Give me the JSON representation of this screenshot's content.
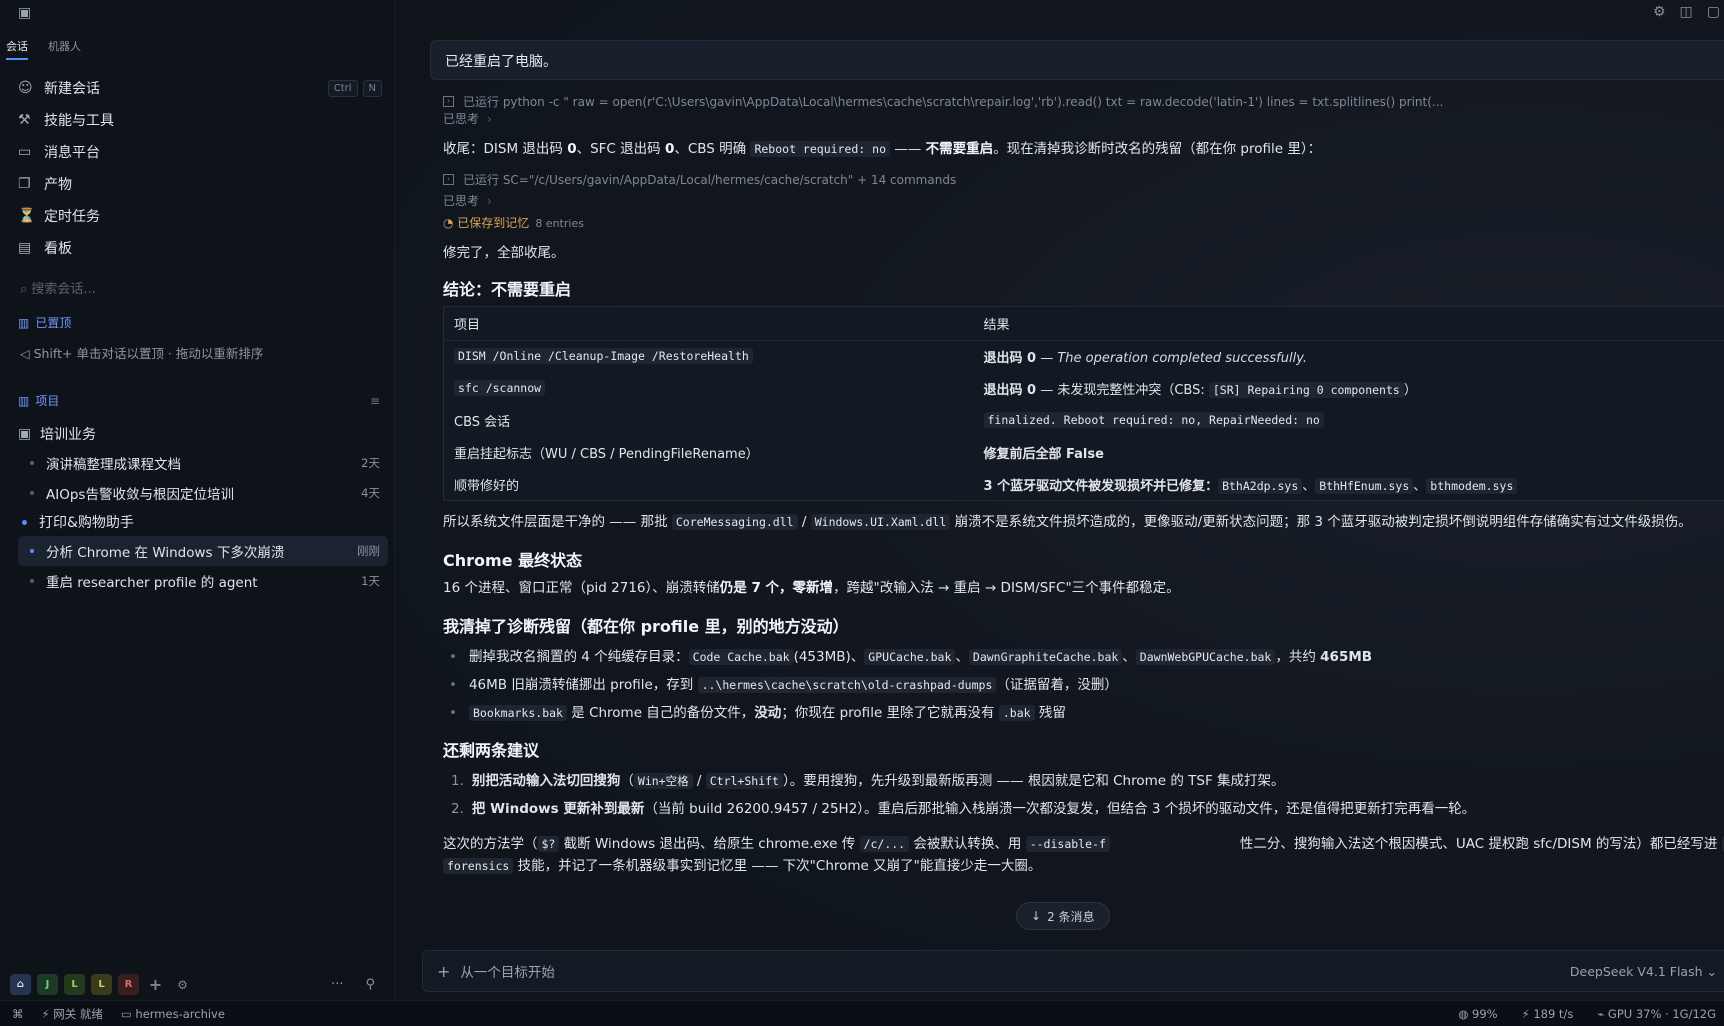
{
  "sidebar": {
    "tabs": [
      "会话",
      "机器人"
    ],
    "menu": [
      {
        "label": "新建会话",
        "icon": "chat-user-icon",
        "shortcut": [
          "Ctrl",
          "N"
        ]
      },
      {
        "label": "技能与工具",
        "icon": "tools-icon"
      },
      {
        "label": "消息平台",
        "icon": "message-icon"
      },
      {
        "label": "产物",
        "icon": "document-icon"
      },
      {
        "label": "定时任务",
        "icon": "timer-icon"
      },
      {
        "label": "看板",
        "icon": "kanban-icon"
      }
    ],
    "search_placeholder": "搜索会话...",
    "pinned_label": "已置顶",
    "pinned_hint": "Shift+ 单击对话以置顶 · 拖动以重新排序",
    "projects_label": "项目",
    "projects": [
      {
        "name": "培训业务",
        "sessions": [
          {
            "title": "演讲稿整理成课程文档",
            "age": "2天"
          },
          {
            "title": "AIOps告警收敛与根因定位培训",
            "age": "4天"
          }
        ]
      },
      {
        "name": "打印&购物助手",
        "sessions": [
          {
            "title": "分析 Chrome 在 Windows 下多次崩溃",
            "age": "刚刚",
            "active": true
          },
          {
            "title": "重启 researcher profile 的 agent",
            "age": "1天"
          }
        ]
      }
    ],
    "workspaces": [
      {
        "label": "J",
        "color": "#2f7a4a"
      },
      {
        "label": "L",
        "color": "#3d6b2f"
      },
      {
        "label": "L",
        "color": "#6b6a2a"
      },
      {
        "label": "R",
        "color": "#7a2f2f"
      }
    ]
  },
  "statusbar": {
    "gateway": "网关 就绪",
    "profile": "hermes-archive",
    "battery": "99%",
    "speed": "189 t/s",
    "gpu": "GPU 37% · 1G/12G"
  },
  "main": {
    "user_message": "已经重启了电脑。",
    "tool1": "已运行 python -c \" raw = open(r'C:\\Users\\gavin\\AppData\\Local\\hermes\\cache\\scratch\\repair.log','rb').read() txt = raw.decode('latin-1') lines = txt.splitlines() print(...",
    "thought": "已思考",
    "summary_pre": "收尾：DISM 退出码 ",
    "summary_b1": "0",
    "summary_mid1": "、SFC 退出码 ",
    "summary_b2": "0",
    "summary_mid2": "、CBS 明确 ",
    "summary_code": "Reboot required: no",
    "summary_mid3": " —— ",
    "summary_b3": "不需要重启",
    "summary_end": "。现在清掉我诊断时改名的残留（都在你 profile 里）：",
    "tool2": "已运行 SC=\"/c/Users/gavin/AppData/Local/hermes/cache/scratch\" + 14 commands",
    "memory": "已保存到记忆",
    "memory_count": "8 entries",
    "done": "修完了，全部收尾。",
    "h_conclusion": "结论：不需要重启",
    "table": {
      "headers": [
        "项目",
        "结果"
      ],
      "rows": [
        {
          "item_code": "DISM /Online /Cleanup-Image /RestoreHealth",
          "res_b": "退出码 0",
          "res_t": " — ",
          "res_em": "The operation completed successfully."
        },
        {
          "item_code": "sfc /scannow",
          "res_b": "退出码 0",
          "res_t": " — 未发现完整性冲突（CBS: ",
          "res_code": "[SR] Repairing 0 components",
          "res_t2": "）"
        },
        {
          "item": "CBS 会话",
          "res_code": "finalized. Reboot required: no, RepairNeeded: no"
        },
        {
          "item": "重启挂起标志（WU / CBS / PendingFileRename）",
          "res_t": "修复前后全部 ",
          "res_b": "False"
        },
        {
          "item": "顺带修好的",
          "res_b": "3 个蓝牙驱动文件被发现损坏并已修复：",
          "codes": [
            "BthA2dp.sys",
            "BthHfEnum.sys",
            "bthmodem.sys"
          ]
        }
      ]
    },
    "p_system_a": "所以系统文件层面是干净的 —— 那批 ",
    "p_system_c1": "CoreMessaging.dll",
    "p_system_sep": " / ",
    "p_system_c2": "Windows.UI.Xaml.dll",
    "p_system_b": " 崩溃不是系统文件损坏造成的，更像驱动/更新状态问题；那 3 个蓝牙驱动被判定损坏倒说明组件存储确实有过文件级损伤。",
    "h_chrome": "Chrome 最终状态",
    "p_chrome_a": "16 个进程、窗口正常（pid 2716）、崩溃转储",
    "p_chrome_b": "仍是 7 个，零新增",
    "p_chrome_c": "，跨越\"改输入法 → 重启 → DISM/SFC\"三个事件都稳定。",
    "h_cleanup": "我清掉了诊断残留（都在你 profile 里，别的地方没动）",
    "cleanup": [
      {
        "a": "删掉我改名搁置的 4 个纯缓存目录：",
        "c1": "Code Cache.bak",
        "b": "(453MB)、",
        "c2": "GPUCache.bak",
        "s1": "、",
        "c3": "DawnGraphiteCache.bak",
        "s2": "、",
        "c4": "DawnWebGPUCache.bak",
        "e": "，共约 ",
        "eb": "465MB"
      },
      {
        "a": "46MB 旧崩溃转储挪出 profile，存到 ",
        "c1": "..\\hermes\\cache\\scratch\\old-crashpad-dumps",
        "b": "（证据留着，没删）"
      },
      {
        "c1": "Bookmarks.bak",
        "a": " 是 Chrome 自己的备份文件，",
        "ab": "没动",
        "b": "；你现在 profile 里除了它就再没有 ",
        "c2": ".bak",
        "e": " 残留"
      }
    ],
    "h_suggest": "还剩两条建议",
    "suggestions": [
      {
        "num": "1.",
        "b": "别把活动输入法切回搜狗",
        "a": "（",
        "c1": "Win+空格",
        "s": " / ",
        "c2": "Ctrl+Shift",
        "e": "）。要用搜狗，先升级到最新版再测 —— 根因就是它和 Chrome 的 TSF 集成打架。"
      },
      {
        "num": "2.",
        "b": "把 Windows 更新补到最新",
        "a": "（当前 build 26200.9457 / 25H2）。重启后那批输入栈崩溃一次都没复发，但结合 3 个损坏的驱动文件，还是值得把更新打完再看一轮。"
      }
    ],
    "p_method_a": "这次的方法学（",
    "p_method_c1": "$?",
    "p_method_b": " 截断 Windows 退出码、给原生 chrome.exe 传 ",
    "p_method_c2": "/c/...",
    "p_method_c": " 会被默认转换、用 ",
    "p_method_c3": "--disable-f",
    "p_method_d": "性二分、搜狗输入法这个根因模式、UAC 提权跑 sfc/DISM 的写法）都已经写进 ",
    "p_method_c4": "c",
    "p_method_c5": "forensics",
    "p_method_e": " 技能，并记了一条机器级事实到记忆里 —— 下次\"Chrome 又崩了\"能直接少走一大圈。",
    "new_messages": "2 条消息",
    "composer_placeholder": "从一个目标开始",
    "model": "DeepSeek V4.1 Flash"
  }
}
